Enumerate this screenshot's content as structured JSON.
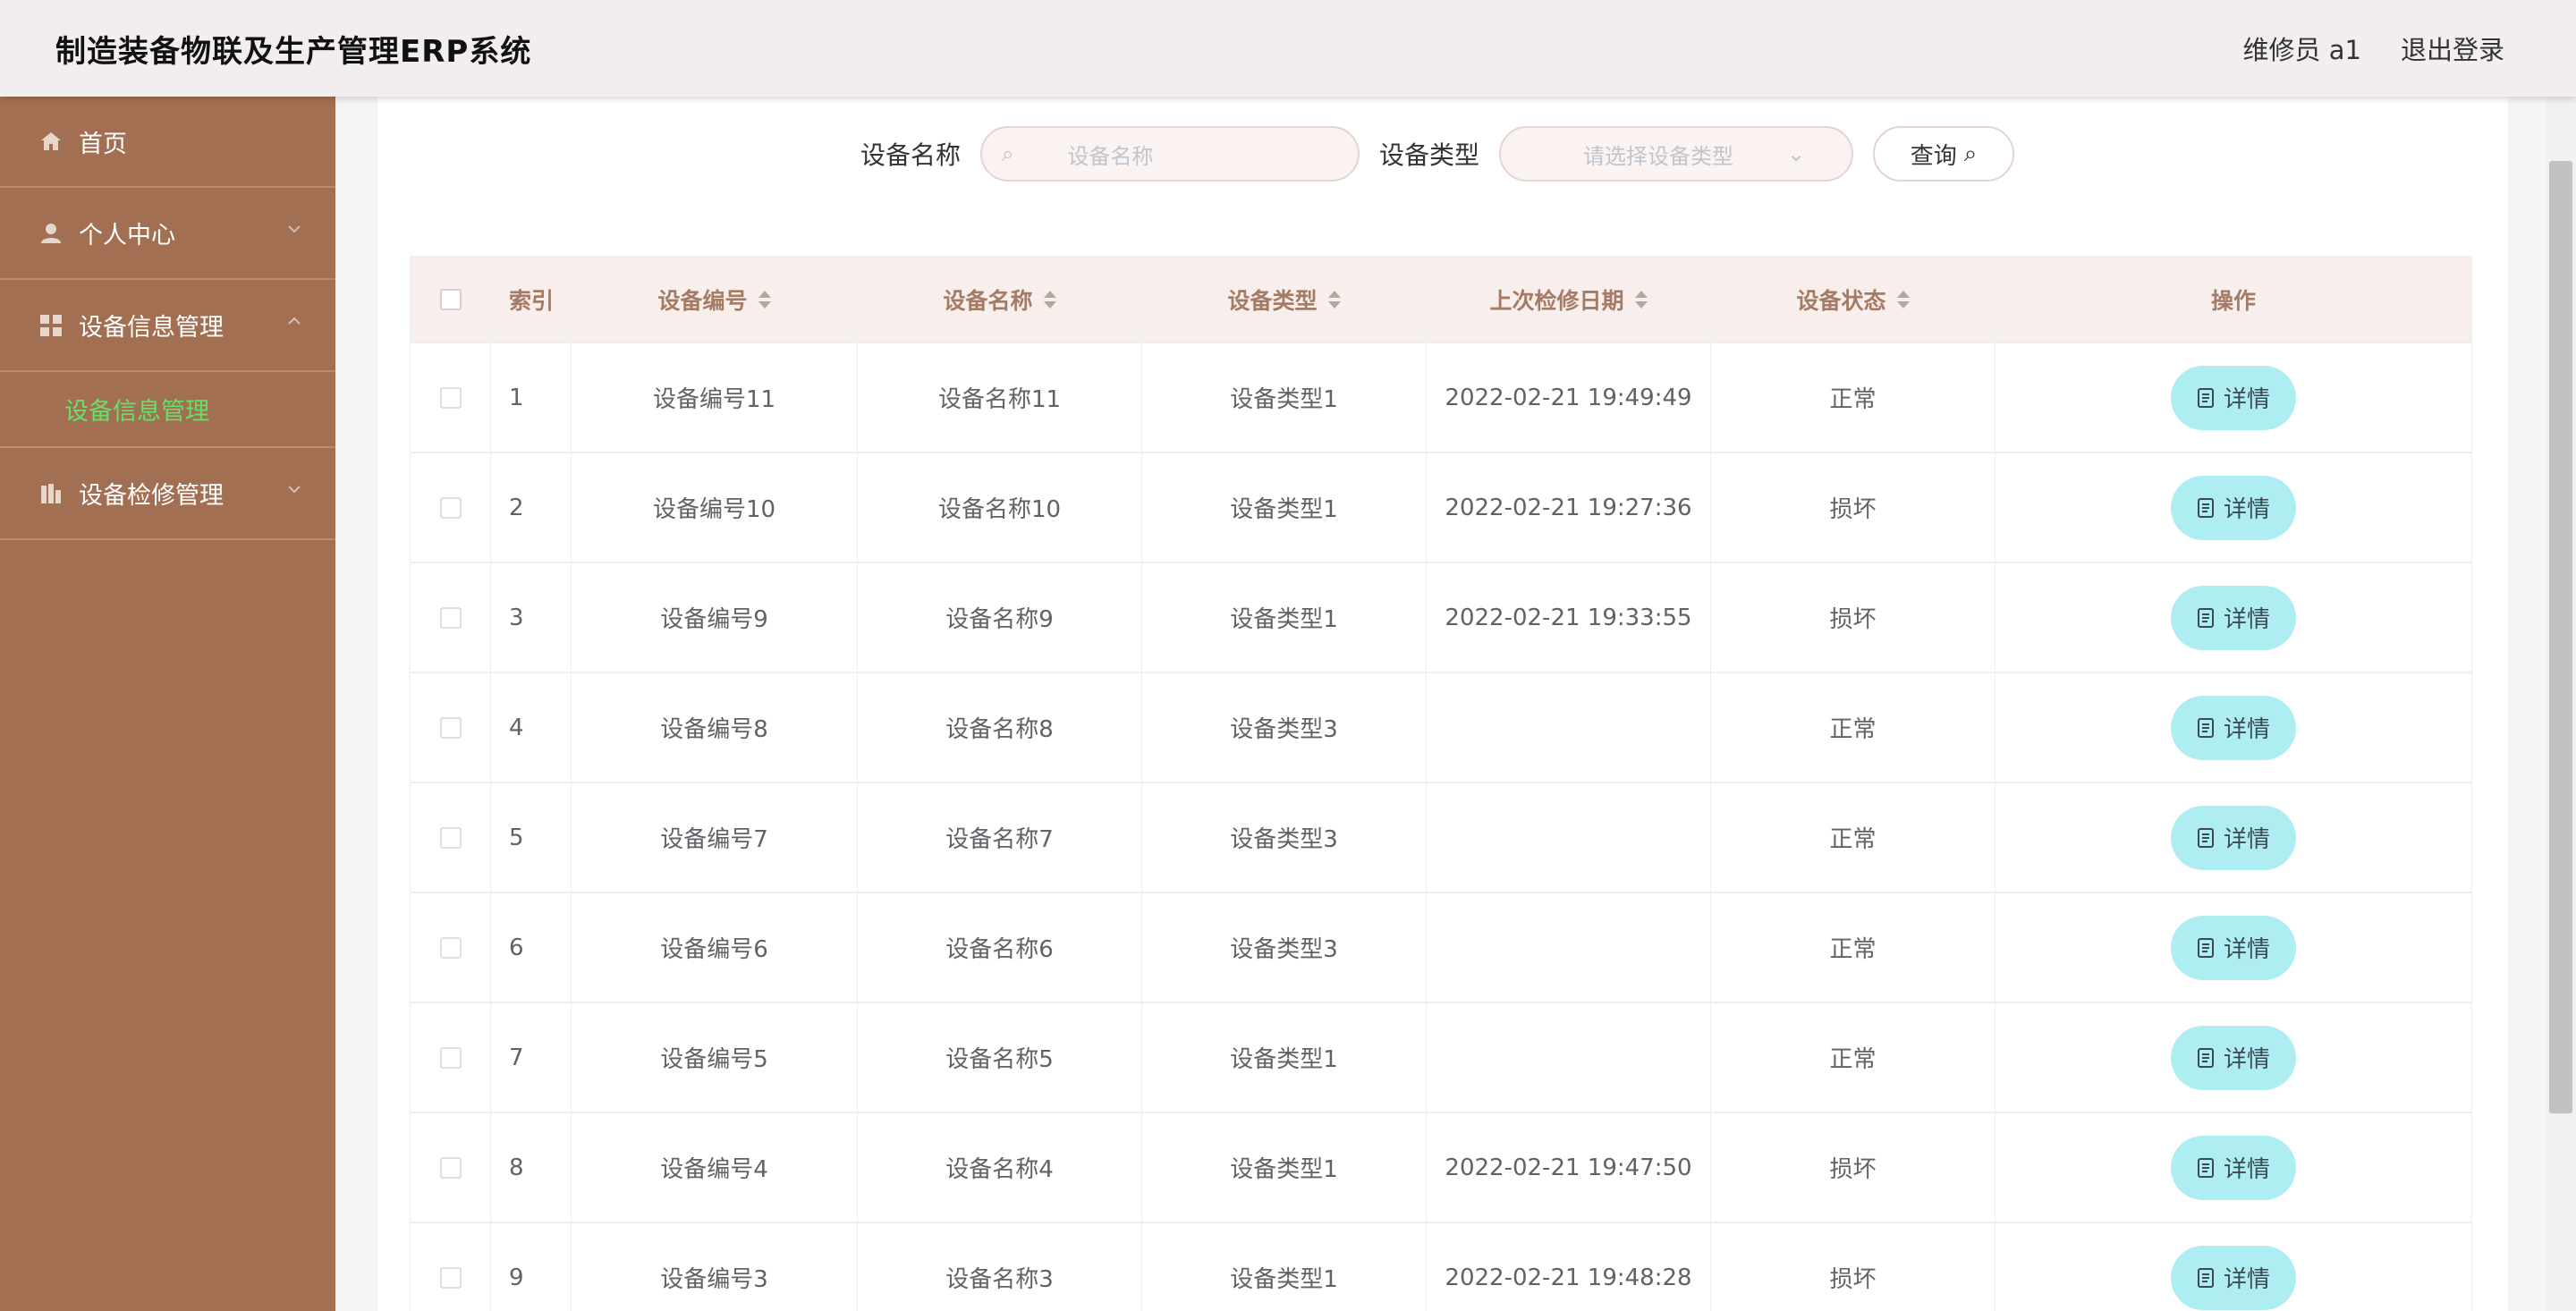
{
  "header": {
    "title": "制造装备物联及生产管理ERP系统",
    "user": "维修员 a1",
    "logout": "退出登录"
  },
  "sidebar": {
    "items": [
      {
        "label": "首页",
        "icon": "home-icon"
      },
      {
        "label": "个人中心",
        "icon": "user-icon"
      },
      {
        "label": "设备信息管理",
        "icon": "grid-icon",
        "expanded": true,
        "children": [
          {
            "label": "设备信息管理",
            "active": true
          }
        ]
      },
      {
        "label": "设备检修管理",
        "icon": "chart-icon"
      }
    ],
    "active_color": "#67e06a",
    "background": "#a26f53"
  },
  "search": {
    "name_label": "设备名称",
    "name_placeholder": "设备名称",
    "type_label": "设备类型",
    "type_placeholder": "请选择设备类型",
    "button": "查询"
  },
  "table": {
    "columns": [
      "索引",
      "设备编号",
      "设备名称",
      "设备类型",
      "上次检修日期",
      "设备状态",
      "操作"
    ],
    "rows": [
      {
        "idx": "1",
        "code": "设备编号11",
        "name": "设备名称11",
        "type": "设备类型1",
        "date": "2022-02-21 19:49:49",
        "status": "正常",
        "op": "详情"
      },
      {
        "idx": "2",
        "code": "设备编号10",
        "name": "设备名称10",
        "type": "设备类型1",
        "date": "2022-02-21 19:27:36",
        "status": "损坏",
        "op": "详情"
      },
      {
        "idx": "3",
        "code": "设备编号9",
        "name": "设备名称9",
        "type": "设备类型1",
        "date": "2022-02-21 19:33:55",
        "status": "损坏",
        "op": "详情"
      },
      {
        "idx": "4",
        "code": "设备编号8",
        "name": "设备名称8",
        "type": "设备类型3",
        "date": "",
        "status": "正常",
        "op": "详情"
      },
      {
        "idx": "5",
        "code": "设备编号7",
        "name": "设备名称7",
        "type": "设备类型3",
        "date": "",
        "status": "正常",
        "op": "详情"
      },
      {
        "idx": "6",
        "code": "设备编号6",
        "name": "设备名称6",
        "type": "设备类型3",
        "date": "",
        "status": "正常",
        "op": "详情"
      },
      {
        "idx": "7",
        "code": "设备编号5",
        "name": "设备名称5",
        "type": "设备类型1",
        "date": "",
        "status": "正常",
        "op": "详情"
      },
      {
        "idx": "8",
        "code": "设备编号4",
        "name": "设备名称4",
        "type": "设备类型1",
        "date": "2022-02-21 19:47:50",
        "status": "损坏",
        "op": "详情"
      },
      {
        "idx": "9",
        "code": "设备编号3",
        "name": "设备名称3",
        "type": "设备类型1",
        "date": "2022-02-21 19:48:28",
        "status": "损坏",
        "op": "详情"
      }
    ],
    "header_bg": "#f8eeec",
    "header_text_color": "#a47b64",
    "button_bg": "#aeeef2"
  }
}
